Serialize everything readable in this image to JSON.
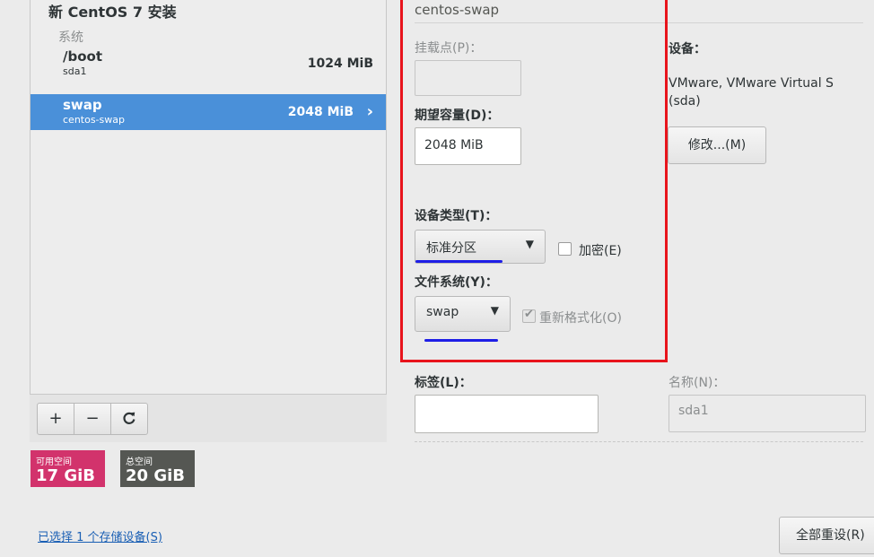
{
  "partitions_panel": {
    "title": "新 CentOS 7 安装",
    "group_label": "系统",
    "items": [
      {
        "name": "/boot",
        "device": "sda1",
        "size": "1024 MiB",
        "selected": false
      },
      {
        "name": "swap",
        "device": "centos-swap",
        "size": "2048 MiB",
        "selected": true
      }
    ],
    "toolbar": {
      "add": "+",
      "remove": "−",
      "refresh": "C"
    }
  },
  "space": {
    "available_label": "可用空间",
    "available_value": "17 GiB",
    "total_label": "总空间",
    "total_value": "20 GiB"
  },
  "storage_link": "已选择 1 个存储设备(S)",
  "details": {
    "section_title": "centos-swap",
    "mount_point_label": "挂载点(P)：",
    "mount_point_value": "",
    "desired_capacity_label": "期望容量(D)：",
    "desired_capacity_value": "2048 MiB",
    "device_type_label": "设备类型(T)：",
    "device_type_value": "标准分区",
    "encrypt_label": "加密(E)",
    "filesystem_label": "文件系统(Y)：",
    "filesystem_value": "swap",
    "reformat_label": "重新格式化(O)",
    "tag_label": "标签(L)：",
    "tag_value": "",
    "name_label": "名称(N)：",
    "name_value": "sda1"
  },
  "device": {
    "label": "设备：",
    "line1": "VMware, VMware Virtual S",
    "line2": "(sda)",
    "modify_button": "修改...(M)"
  },
  "reset_button": "全部重设(R)",
  "colors": {
    "selected_row": "#4a90d9",
    "available_space": "#d2336c",
    "total_space": "#555753",
    "highlight_box": "#e8141c",
    "annotation_underline": "#1e1ee6",
    "link": "#1a5fb4"
  }
}
